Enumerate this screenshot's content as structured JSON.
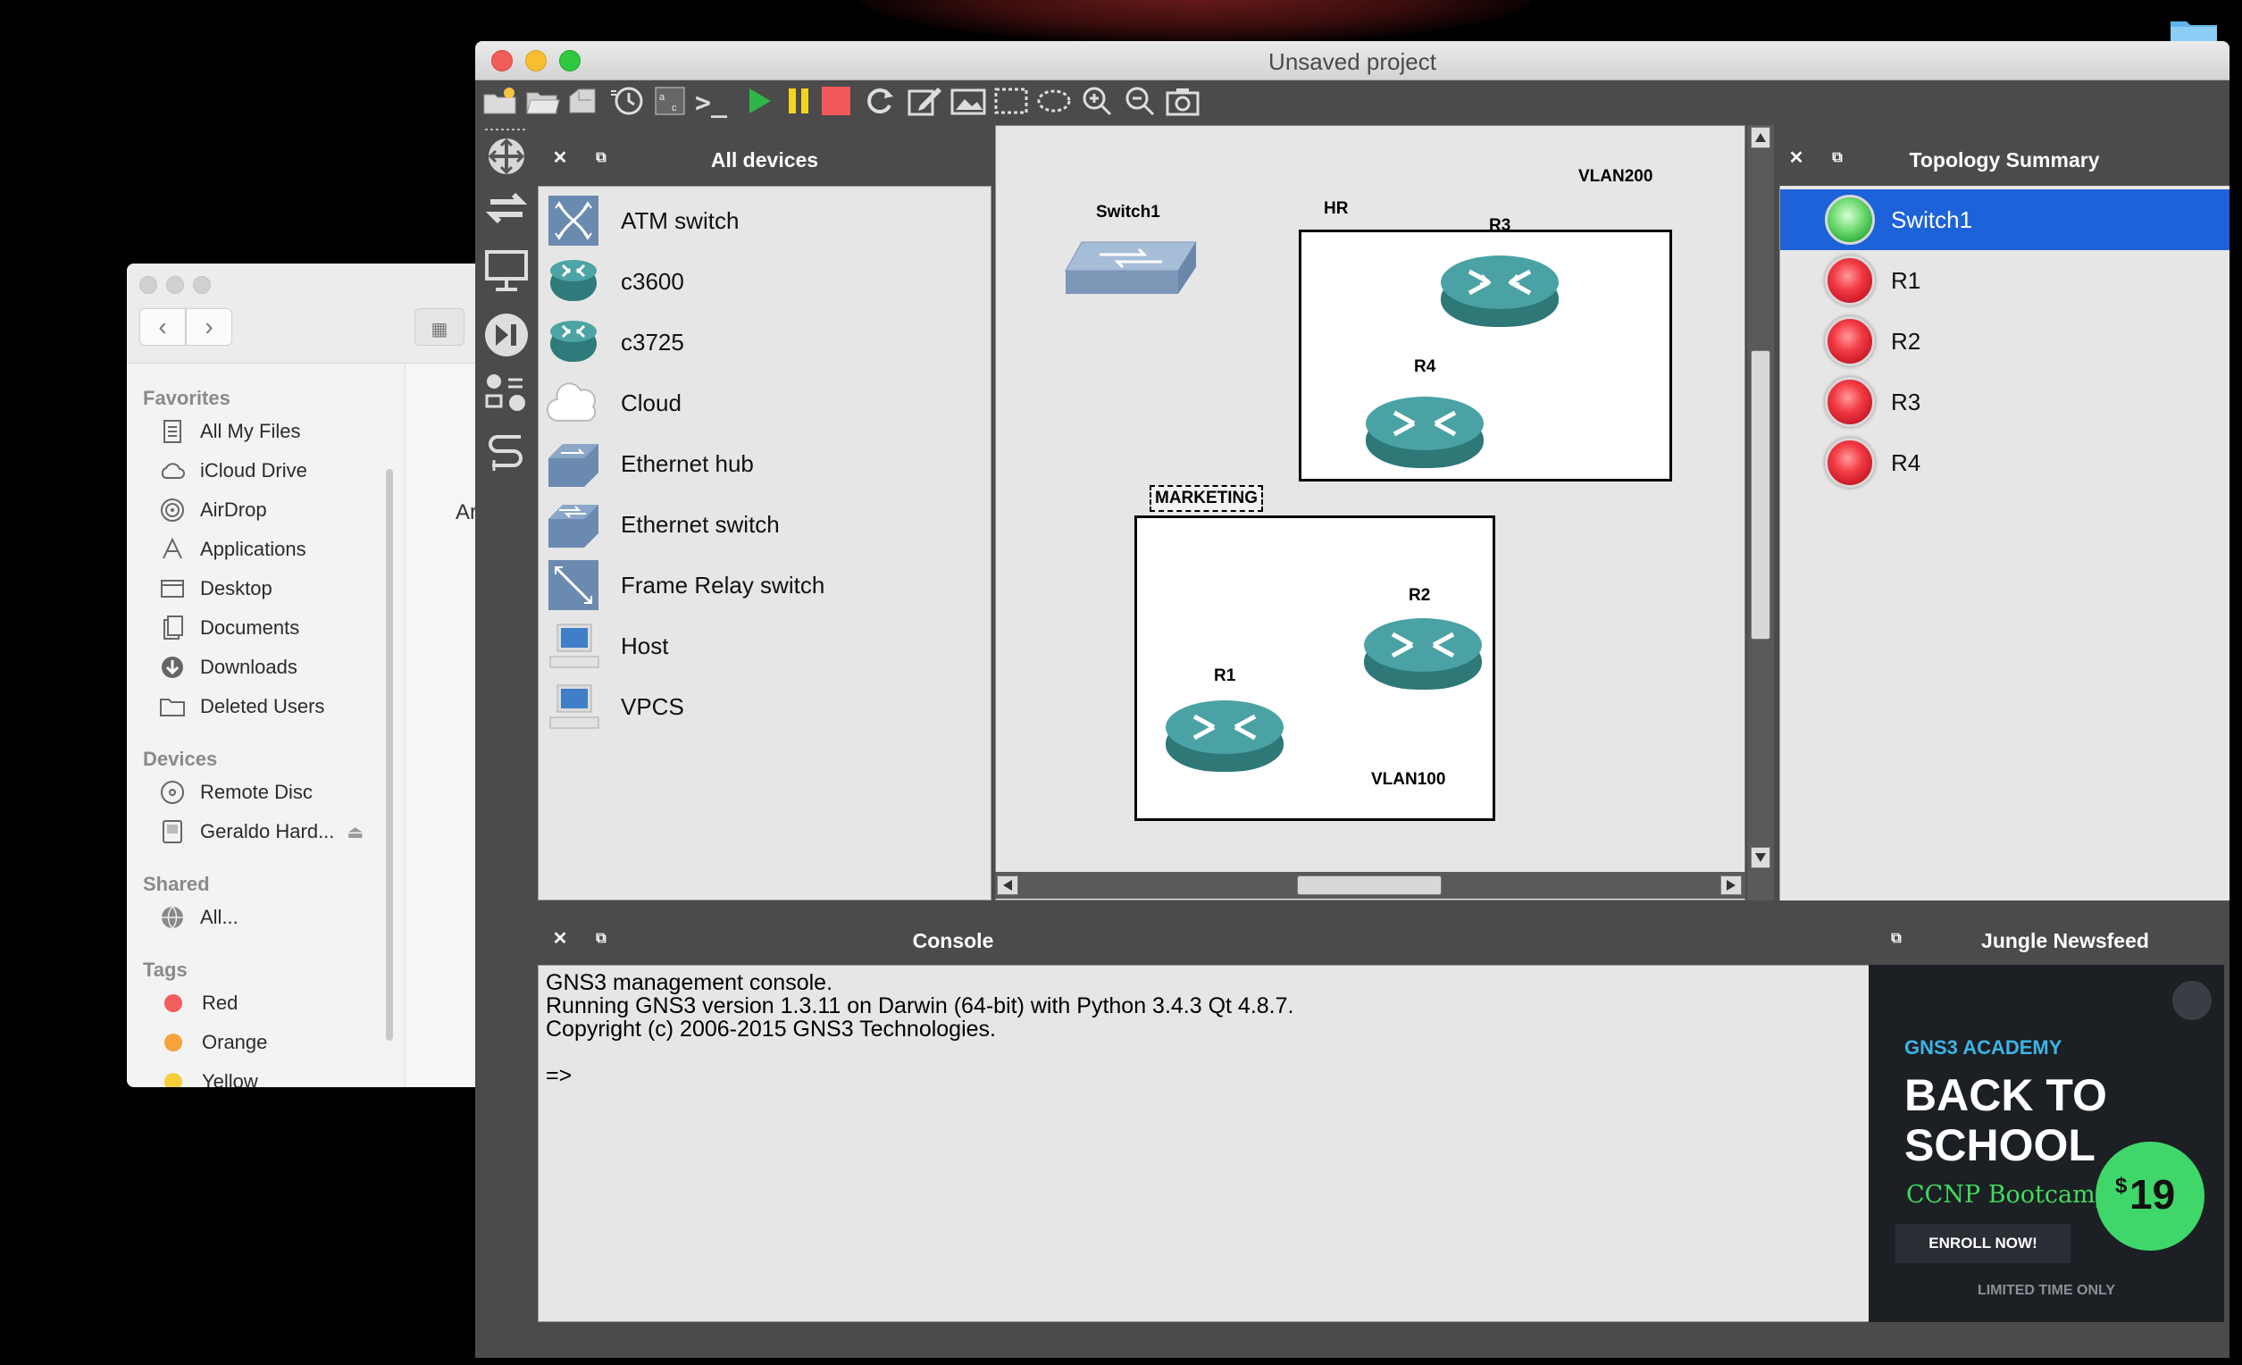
{
  "finder": {
    "sections": {
      "favorites": "Favorites",
      "devices": "Devices",
      "shared": "Shared",
      "tags": "Tags"
    },
    "favorites": [
      "All My Files",
      "iCloud Drive",
      "AirDrop",
      "Applications",
      "Desktop",
      "Documents",
      "Downloads",
      "Deleted Users"
    ],
    "devices": [
      "Remote Disc",
      "Geraldo Hard..."
    ],
    "shared": [
      "All..."
    ],
    "tags": [
      {
        "label": "Red",
        "color": "#f25d5d"
      },
      {
        "label": "Orange",
        "color": "#f5a33a"
      },
      {
        "label": "Yellow",
        "color": "#f5cf3a"
      }
    ],
    "content_fragment": "Ar"
  },
  "gns3": {
    "window_title": "Unsaved project",
    "colors": {
      "close": "#f25d58",
      "minimize": "#f8be32",
      "zoom": "#2fc840",
      "selection": "#1d62d8",
      "play": "#2fb548",
      "pause": "#f5d321",
      "stop": "#f2585a"
    },
    "all_devices": {
      "title": "All devices",
      "items": [
        "ATM switch",
        "c3600",
        "c3725",
        "Cloud",
        "Ethernet hub",
        "Ethernet switch",
        "Frame Relay switch",
        "Host",
        "VPCS"
      ]
    },
    "topology_summary": {
      "title": "Topology Summary",
      "items": [
        {
          "label": "Switch1",
          "status": "running",
          "selected": true
        },
        {
          "label": "R1",
          "status": "stopped"
        },
        {
          "label": "R2",
          "status": "stopped"
        },
        {
          "label": "R3",
          "status": "stopped"
        },
        {
          "label": "R4",
          "status": "stopped"
        }
      ]
    },
    "canvas": {
      "labels": {
        "switch1": "Switch1",
        "hr": "HR",
        "vlan200": "VLAN200",
        "r3": "R3",
        "r4": "R4",
        "marketing": "MARKETING",
        "r2": "R2",
        "r1": "R1",
        "vlan100": "VLAN100"
      }
    },
    "console": {
      "title": "Console",
      "lines": [
        "GNS3 management console.",
        "Running GNS3 version 1.3.11 on Darwin (64-bit) with Python 3.4.3 Qt 4.8.7.",
        "Copyright (c) 2006-2015 GNS3 Technologies.",
        "",
        "=>"
      ]
    },
    "newsfeed": {
      "title": "Jungle Newsfeed",
      "brand": "GNS3 ACADEMY",
      "headline_1": "BACK TO",
      "headline_2": "SCHOOL",
      "course": "CCNP Bootcamp",
      "cta": "ENROLL NOW!",
      "price_symbol": "$",
      "price": "19",
      "footer": "LIMITED TIME ONLY"
    }
  }
}
